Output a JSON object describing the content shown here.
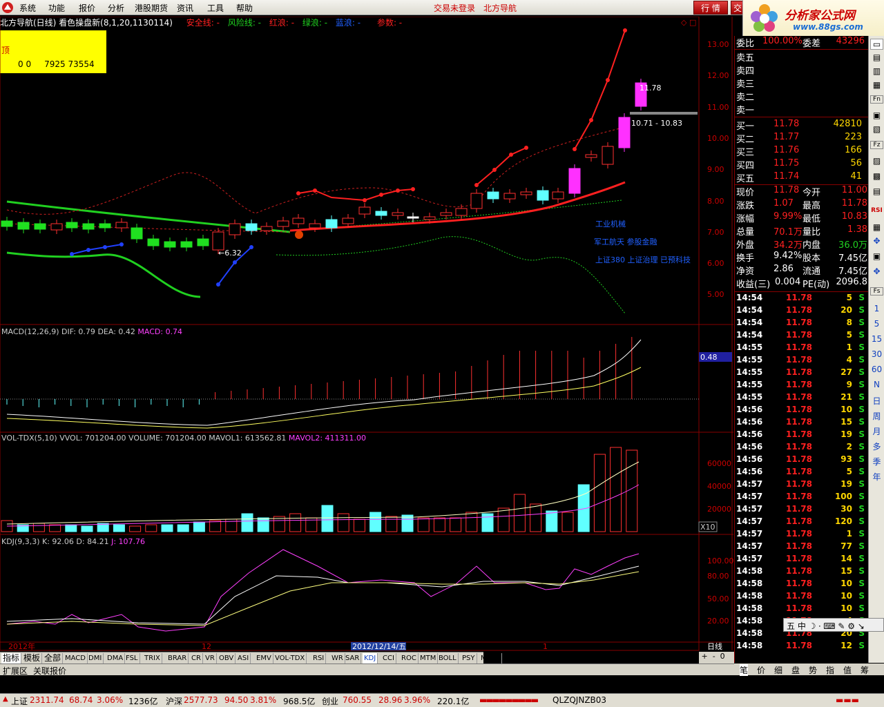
{
  "menu": {
    "items": [
      "系统",
      "功能",
      "报价",
      "分析",
      "港股期货",
      "资讯",
      "工具",
      "帮助"
    ],
    "status_left": "交易未登录",
    "status_right": "北方导航",
    "btn_quote": "行 情",
    "btn_trade": "交"
  },
  "brand": {
    "title": "分析家公式网",
    "url": "www.88gs.com"
  },
  "chart": {
    "title": "北方导航(日线) 看色操盘新(8,1,20,1130114)",
    "legend": [
      {
        "label": "安全线: -",
        "color": "#ff3030"
      },
      {
        "label": "风险线: -",
        "color": "#20d020"
      },
      {
        "label": "红浪: -",
        "color": "#ff3030"
      },
      {
        "label": "绿浪: -",
        "color": "#20d020"
      },
      {
        "label": "蓝浪: -",
        "color": "#2060ff"
      },
      {
        "label": "参数: -",
        "color": "#ff3030"
      }
    ],
    "top_label": "顶",
    "ybox_values": "0 0     7925 73554",
    "price_ticks": [
      "13.00",
      "12.00",
      "11.00",
      "10.00",
      "9.00",
      "8.00",
      "7.00",
      "6.00",
      "5.00"
    ],
    "annot_high": "11.78",
    "annot_range": "10.71 - 10.83",
    "annot_low": "←6.32",
    "concepts": [
      "工业机械",
      "军工航天 参股金融",
      "上证380 上证治理 已预科技"
    ]
  },
  "chart_data": [
    {
      "type": "candlestick",
      "series": [
        {
          "name": "K线",
          "close_last": 11.78,
          "low_marker": 6.32
        }
      ],
      "ylim": [
        4.5,
        13.5
      ]
    },
    {
      "type": "bar",
      "title": "MACD(12,26,9)",
      "series": [
        {
          "name": "DIF",
          "last": 0.79
        },
        {
          "name": "DEA",
          "last": 0.42
        },
        {
          "name": "MACD",
          "last": 0.74
        }
      ]
    },
    {
      "type": "bar",
      "title": "VOL-TDX(5,10)",
      "series": [
        {
          "name": "VOLUME",
          "last": 701204.0
        },
        {
          "name": "MAVOL1",
          "last": 613562.81
        },
        {
          "name": "MAVOL2",
          "last": 411311.0
        }
      ],
      "ylim": [
        0,
        70000
      ]
    },
    {
      "type": "line",
      "title": "KDJ(9,3,3)",
      "series": [
        {
          "name": "K",
          "last": 92.06
        },
        {
          "name": "D",
          "last": 84.21
        },
        {
          "name": "J",
          "last": 107.76
        }
      ],
      "ylim": [
        0,
        110
      ]
    }
  ],
  "macd": {
    "head": "MACD(12,26,9)",
    "dif": "DIF: 0.79",
    "dea": "DEA: 0.42",
    "macd": "MACD: 0.74",
    "axis": "0.48"
  },
  "vol": {
    "head": "VOL-TDX(5,10)",
    "vvol": "VVOL: 701204.00",
    "volume": "VOLUME: 701204.00",
    "mavol1": "MAVOL1: 613562.81",
    "mavol2": "MAVOL2: 411311.00",
    "ticks": [
      "60000",
      "40000",
      "20000"
    ],
    "unit": "X10"
  },
  "kdj": {
    "head": "KDJ(9,3,3)",
    "k": "K: 92.06",
    "d": "D: 84.21",
    "j": "J: 107.76",
    "ticks": [
      "100.00",
      "80.00",
      "50.00",
      "20.00"
    ]
  },
  "dates": {
    "year": "2012年",
    "m12": "12",
    "sel": "2012/12/14/五",
    "m1": "1",
    "period": "日线"
  },
  "orderbook": {
    "weibi": "委比",
    "weibi_v": "100.00%",
    "weicha": "委差",
    "weicha_v": "43296",
    "sell": [
      "卖五",
      "卖四",
      "卖三",
      "卖二",
      "卖一"
    ],
    "buy": [
      {
        "l": "买一",
        "p": "11.78",
        "v": "42810"
      },
      {
        "l": "买二",
        "p": "11.77",
        "v": "223"
      },
      {
        "l": "买三",
        "p": "11.76",
        "v": "166"
      },
      {
        "l": "买四",
        "p": "11.75",
        "v": "56"
      },
      {
        "l": "买五",
        "p": "11.74",
        "v": "41"
      }
    ],
    "stats": [
      {
        "a": "现价",
        "av": "11.78",
        "b": "今开",
        "bv": "11.00"
      },
      {
        "a": "涨跌",
        "av": "1.07",
        "b": "最高",
        "bv": "11.78"
      },
      {
        "a": "涨幅",
        "av": "9.99%",
        "b": "最低",
        "bv": "10.83"
      },
      {
        "a": "总量",
        "av": "70.1万",
        "b": "量比",
        "bv": "1.38"
      },
      {
        "a": "外盘",
        "av": "34.2万",
        "b": "内盘",
        "bv": "36.0万"
      },
      {
        "a": "换手",
        "av": "9.42%",
        "b": "股本",
        "bv": "7.45亿"
      },
      {
        "a": "净资",
        "av": "2.86",
        "b": "流通",
        "bv": "7.45亿"
      },
      {
        "a": "收益(三)",
        "av": "0.004",
        "b": "PE(动)",
        "bv": "2096.8"
      }
    ]
  },
  "ticks": [
    [
      "14:54",
      "11.78",
      "5",
      "S"
    ],
    [
      "14:54",
      "11.78",
      "20",
      "S"
    ],
    [
      "14:54",
      "11.78",
      "8",
      "S"
    ],
    [
      "14:54",
      "11.78",
      "5",
      "S"
    ],
    [
      "14:55",
      "11.78",
      "1",
      "S"
    ],
    [
      "14:55",
      "11.78",
      "4",
      "S"
    ],
    [
      "14:55",
      "11.78",
      "27",
      "S"
    ],
    [
      "14:55",
      "11.78",
      "9",
      "S"
    ],
    [
      "14:55",
      "11.78",
      "21",
      "S"
    ],
    [
      "14:56",
      "11.78",
      "10",
      "S"
    ],
    [
      "14:56",
      "11.78",
      "15",
      "S"
    ],
    [
      "14:56",
      "11.78",
      "19",
      "S"
    ],
    [
      "14:56",
      "11.78",
      "2",
      "S"
    ],
    [
      "14:56",
      "11.78",
      "93",
      "S"
    ],
    [
      "14:56",
      "11.78",
      "5",
      "S"
    ],
    [
      "14:57",
      "11.78",
      "19",
      "S"
    ],
    [
      "14:57",
      "11.78",
      "100",
      "S"
    ],
    [
      "14:57",
      "11.78",
      "30",
      "S"
    ],
    [
      "14:57",
      "11.78",
      "120",
      "S"
    ],
    [
      "14:57",
      "11.78",
      "1",
      "S"
    ],
    [
      "14:57",
      "11.78",
      "77",
      "S"
    ],
    [
      "14:57",
      "11.78",
      "14",
      "S"
    ],
    [
      "14:58",
      "11.78",
      "15",
      "S"
    ],
    [
      "14:58",
      "11.78",
      "10",
      "S"
    ],
    [
      "14:58",
      "11.78",
      "10",
      "S"
    ],
    [
      "14:58",
      "11.78",
      "10",
      "S"
    ],
    [
      "14:58",
      "11.78",
      "4",
      "S"
    ],
    [
      "14:58",
      "11.78",
      "20",
      "S"
    ],
    [
      "14:58",
      "11.78",
      "12",
      "S"
    ]
  ],
  "sidebar": [
    "1",
    "5",
    "15",
    "30",
    "60",
    "N",
    "日",
    "周",
    "月",
    "多",
    "季",
    "年"
  ],
  "tabs": [
    "指标",
    "模板",
    "全部",
    "MACD",
    "DMI",
    "DMA",
    "FSL",
    "TRIX",
    "BRAR",
    "CR",
    "VR",
    "OBV",
    "ASI",
    "EMV",
    "VOL-TDX",
    "RSI",
    "WR",
    "SAR",
    "KDJ",
    "CCI",
    "ROC",
    "MTM",
    "BOLL",
    "PSY",
    "MCST"
  ],
  "tabs2": [
    "扩展区",
    "关联报价"
  ],
  "rtabs": [
    "笔",
    "价",
    "细",
    "盘",
    "势",
    "指",
    "值",
    "筹"
  ],
  "statusbar": {
    "sh": "上证",
    "sh_v": "2311.74",
    "sh_c": "68.74",
    "sh_p": "3.06%",
    "sh_a": "1236亿",
    "hs": "沪深",
    "hs_v": "2577.73",
    "hs_c": "94.50",
    "hs_p": "3.81%",
    "hs_a": "968.5亿",
    "cy": "创业",
    "cy_v": "760.55",
    "cy_c": "28.96",
    "cy_p": "3.96%",
    "cy_a": "220.1亿",
    "code": "QLZQJNZB03"
  },
  "ime": "五 中 ☽ ⸱ ⌨ ✎ ⚙ ↘"
}
